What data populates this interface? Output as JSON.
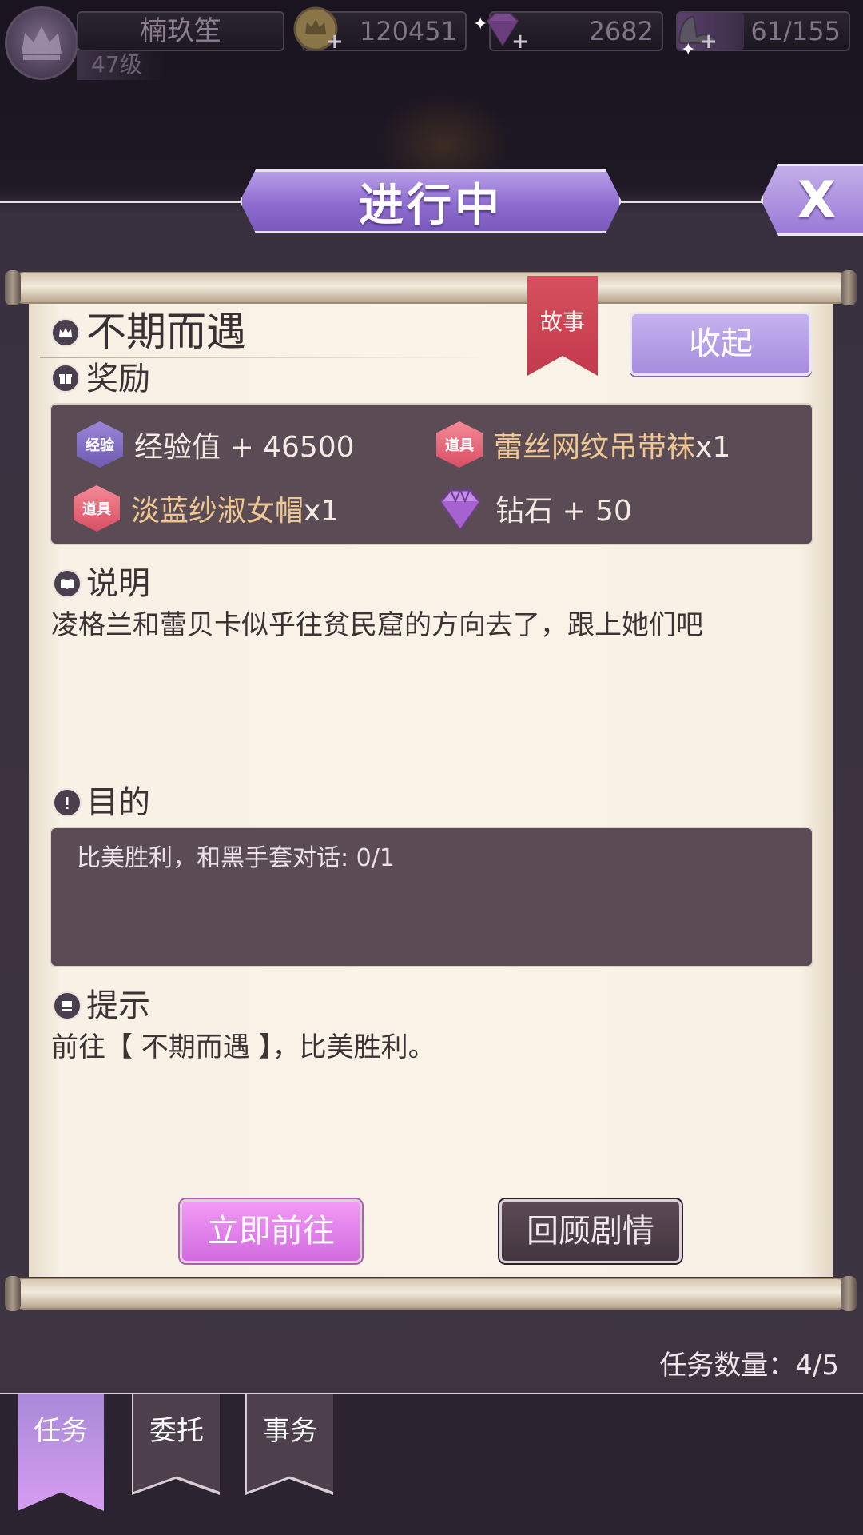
{
  "player": {
    "name": "楠玖笙",
    "level": "47级"
  },
  "resources": {
    "gold": "120451",
    "diamonds": "2682",
    "stamina": "61/155",
    "stamina_fraction": 0.39
  },
  "header": {
    "status_title": "进行中",
    "close_label": "X"
  },
  "quest": {
    "title": "不期而遇",
    "category_ribbon": "故事",
    "collapse_label": "收起"
  },
  "rewards": {
    "section_label": "奖励",
    "items": [
      {
        "badge": "经验",
        "badge_type": "exp",
        "name": "经验值 + 46500",
        "qty": ""
      },
      {
        "badge": "道具",
        "badge_type": "item",
        "name": "蕾丝网纹吊带袜",
        "qty": "x1"
      },
      {
        "badge": "道具",
        "badge_type": "item",
        "name": "淡蓝纱淑女帽",
        "qty": "x1"
      },
      {
        "badge": "",
        "badge_type": "diamond",
        "name": "钻石 + 50",
        "qty": ""
      }
    ]
  },
  "description": {
    "section_label": "说明",
    "text": "凌格兰和蕾贝卡似乎往贫民窟的方向去了，跟上她们吧"
  },
  "objective": {
    "section_label": "目的",
    "text": "比美胜利，和黑手套对话: 0/1"
  },
  "hint": {
    "section_label": "提示",
    "text": "前往【 不期而遇 】，比美胜利。"
  },
  "actions": {
    "go_label": "立即前往",
    "review_label": "回顾剧情"
  },
  "footer": {
    "task_count": "任务数量：4/5"
  },
  "tabs": [
    {
      "label": "任务",
      "active": true
    },
    {
      "label": "委托",
      "active": false
    },
    {
      "label": "事务",
      "active": false
    }
  ]
}
